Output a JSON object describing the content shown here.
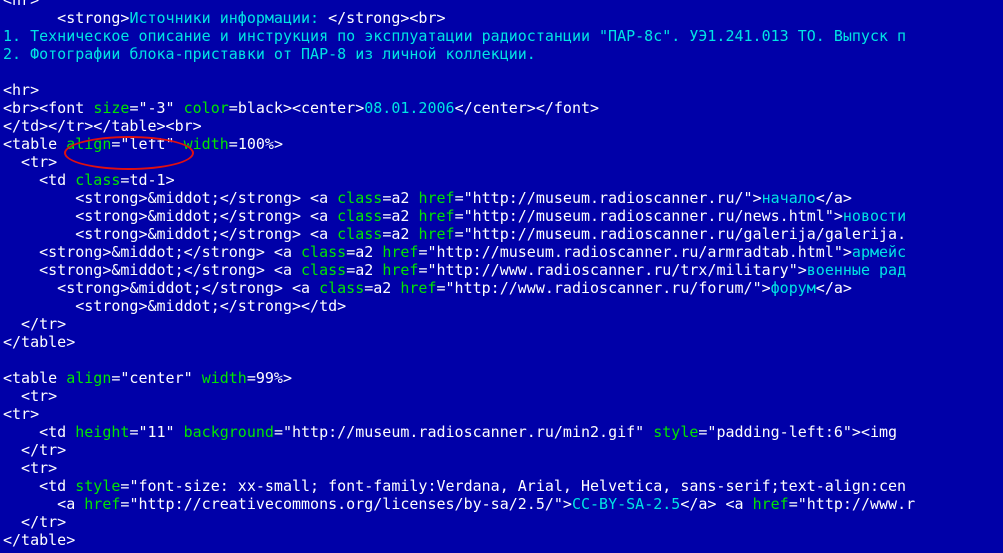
{
  "theme": {
    "background": "#0000a8",
    "white": "#ffffff",
    "tag": "#ffffff",
    "attr": "#00e400",
    "value": "#ffffff",
    "text": "#00e4e4",
    "entity": "#ffffff",
    "annotation": "#e01010"
  },
  "code": {
    "lines": [
      [
        [
          "tag",
          "<hr>"
        ]
      ],
      [
        [
          "tag",
          "      <strong>"
        ],
        [
          "text",
          "Источники информации: "
        ],
        [
          "tag",
          "</strong><br>"
        ]
      ],
      [
        [
          "text",
          "1. Техническое описание и инструкция по эксплуатации радиостанции \"ПАР-8с\". УЭ1.241.013 ТО. Выпуск п"
        ]
      ],
      [
        [
          "text",
          "2. Фотографии блока-приставки от ПАР-8 из личной коллекции."
        ]
      ],
      [
        [
          "text",
          ""
        ]
      ],
      [
        [
          "tag",
          "<hr>"
        ]
      ],
      [
        [
          "tag",
          "<br><font "
        ],
        [
          "attr",
          "size"
        ],
        [
          "tag",
          "="
        ],
        [
          "value",
          "\"-3\""
        ],
        [
          "tag",
          " "
        ],
        [
          "attr",
          "color"
        ],
        [
          "tag",
          "="
        ],
        [
          "value",
          "black"
        ],
        [
          "tag",
          "><center>"
        ],
        [
          "text",
          "08.01.2006"
        ],
        [
          "tag",
          "</center></font>"
        ]
      ],
      [
        [
          "tag",
          "</td></tr></table><br>"
        ]
      ],
      [
        [
          "tag",
          "<table "
        ],
        [
          "attr",
          "align"
        ],
        [
          "tag",
          "="
        ],
        [
          "value",
          "\"left\""
        ],
        [
          "tag",
          " "
        ],
        [
          "attr",
          "width"
        ],
        [
          "tag",
          "="
        ],
        [
          "value",
          "100%"
        ],
        [
          "tag",
          ">"
        ]
      ],
      [
        [
          "tag",
          "  <tr>"
        ]
      ],
      [
        [
          "tag",
          "    <td "
        ],
        [
          "attr",
          "class"
        ],
        [
          "tag",
          "="
        ],
        [
          "value",
          "td-1"
        ],
        [
          "tag",
          ">"
        ]
      ],
      [
        [
          "tag",
          "        <strong>"
        ],
        [
          "entity",
          "&middot;"
        ],
        [
          "tag",
          "</strong> <a "
        ],
        [
          "attr",
          "class"
        ],
        [
          "tag",
          "="
        ],
        [
          "value",
          "a2"
        ],
        [
          "tag",
          " "
        ],
        [
          "attr",
          "href"
        ],
        [
          "tag",
          "="
        ],
        [
          "value",
          "\"http://museum.radioscanner.ru/\""
        ],
        [
          "tag",
          ">"
        ],
        [
          "text",
          "начало"
        ],
        [
          "tag",
          "</a>"
        ]
      ],
      [
        [
          "tag",
          "        <strong>"
        ],
        [
          "entity",
          "&middot;"
        ],
        [
          "tag",
          "</strong> <a "
        ],
        [
          "attr",
          "class"
        ],
        [
          "tag",
          "="
        ],
        [
          "value",
          "a2"
        ],
        [
          "tag",
          " "
        ],
        [
          "attr",
          "href"
        ],
        [
          "tag",
          "="
        ],
        [
          "value",
          "\"http://museum.radioscanner.ru/news.html\""
        ],
        [
          "tag",
          ">"
        ],
        [
          "text",
          "новости"
        ]
      ],
      [
        [
          "tag",
          "        <strong>"
        ],
        [
          "entity",
          "&middot;"
        ],
        [
          "tag",
          "</strong> <a "
        ],
        [
          "attr",
          "class"
        ],
        [
          "tag",
          "="
        ],
        [
          "value",
          "a2"
        ],
        [
          "tag",
          " "
        ],
        [
          "attr",
          "href"
        ],
        [
          "tag",
          "="
        ],
        [
          "value",
          "\"http://museum.radioscanner.ru/galerija/galerija."
        ]
      ],
      [
        [
          "tag",
          "    <strong>"
        ],
        [
          "entity",
          "&middot;"
        ],
        [
          "tag",
          "</strong> <a "
        ],
        [
          "attr",
          "class"
        ],
        [
          "tag",
          "="
        ],
        [
          "value",
          "a2"
        ],
        [
          "tag",
          " "
        ],
        [
          "attr",
          "href"
        ],
        [
          "tag",
          "="
        ],
        [
          "value",
          "\"http://museum.radioscanner.ru/armradtab.html\""
        ],
        [
          "tag",
          ">"
        ],
        [
          "text",
          "армейс"
        ]
      ],
      [
        [
          "tag",
          "    <strong>"
        ],
        [
          "entity",
          "&middot;"
        ],
        [
          "tag",
          "</strong> <a "
        ],
        [
          "attr",
          "class"
        ],
        [
          "tag",
          "="
        ],
        [
          "value",
          "a2"
        ],
        [
          "tag",
          " "
        ],
        [
          "attr",
          "href"
        ],
        [
          "tag",
          "="
        ],
        [
          "value",
          "\"http://www.radioscanner.ru/trx/military\""
        ],
        [
          "tag",
          ">"
        ],
        [
          "text",
          "военные рад"
        ]
      ],
      [
        [
          "tag",
          "      <strong>"
        ],
        [
          "entity",
          "&middot;"
        ],
        [
          "tag",
          "</strong> <a "
        ],
        [
          "attr",
          "class"
        ],
        [
          "tag",
          "="
        ],
        [
          "value",
          "a2"
        ],
        [
          "tag",
          " "
        ],
        [
          "attr",
          "href"
        ],
        [
          "tag",
          "="
        ],
        [
          "value",
          "\"http://www.radioscanner.ru/forum/\""
        ],
        [
          "tag",
          ">"
        ],
        [
          "text",
          "форум"
        ],
        [
          "tag",
          "</a>"
        ]
      ],
      [
        [
          "tag",
          "        <strong>"
        ],
        [
          "entity",
          "&middot;"
        ],
        [
          "tag",
          "</strong></td>"
        ]
      ],
      [
        [
          "tag",
          "  </tr>"
        ]
      ],
      [
        [
          "tag",
          "</table>"
        ]
      ],
      [
        [
          "text",
          ""
        ]
      ],
      [
        [
          "tag",
          "<table "
        ],
        [
          "attr",
          "align"
        ],
        [
          "tag",
          "="
        ],
        [
          "value",
          "\"center\""
        ],
        [
          "tag",
          " "
        ],
        [
          "attr",
          "width"
        ],
        [
          "tag",
          "="
        ],
        [
          "value",
          "99%"
        ],
        [
          "tag",
          ">"
        ]
      ],
      [
        [
          "tag",
          "  <tr>"
        ]
      ],
      [
        [
          "tag",
          "<tr>"
        ]
      ],
      [
        [
          "tag",
          "    <td "
        ],
        [
          "attr",
          "height"
        ],
        [
          "tag",
          "="
        ],
        [
          "value",
          "\"11\""
        ],
        [
          "tag",
          " "
        ],
        [
          "attr",
          "background"
        ],
        [
          "tag",
          "="
        ],
        [
          "value",
          "\"http://museum.radioscanner.ru/min2.gif\""
        ],
        [
          "tag",
          " "
        ],
        [
          "attr",
          "style"
        ],
        [
          "tag",
          "="
        ],
        [
          "value",
          "\"padding-left:6\""
        ],
        [
          "tag",
          "><img"
        ]
      ],
      [
        [
          "tag",
          "  </tr>"
        ]
      ],
      [
        [
          "tag",
          "  <tr>"
        ]
      ],
      [
        [
          "tag",
          "    <td "
        ],
        [
          "attr",
          "style"
        ],
        [
          "tag",
          "="
        ],
        [
          "value",
          "\"font-size: xx-small; font-family:Verdana, Arial, Helvetica, sans-serif;text-align:cen"
        ]
      ],
      [
        [
          "tag",
          "      <a "
        ],
        [
          "attr",
          "href"
        ],
        [
          "tag",
          "="
        ],
        [
          "value",
          "\"http://creativecommons.org/licenses/by-sa/2.5/\""
        ],
        [
          "tag",
          ">"
        ],
        [
          "text",
          "CC-BY-SA-2.5"
        ],
        [
          "tag",
          "</a> <a "
        ],
        [
          "attr",
          "href"
        ],
        [
          "tag",
          "="
        ],
        [
          "value",
          "\"http://www.r"
        ]
      ],
      [
        [
          "tag",
          "  </tr>"
        ]
      ],
      [
        [
          "tag",
          "</table>"
        ]
      ]
    ]
  }
}
